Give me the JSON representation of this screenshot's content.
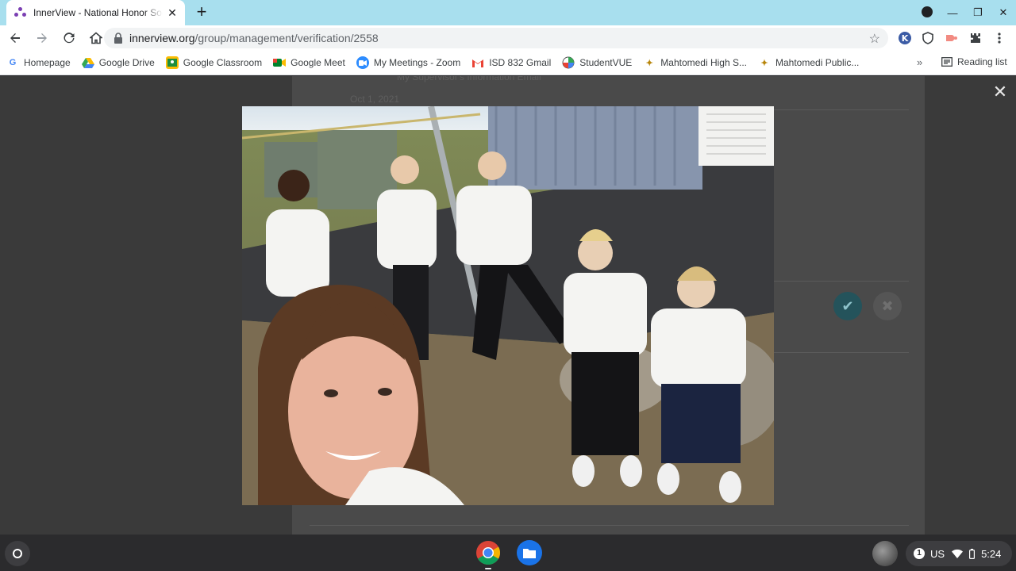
{
  "browser": {
    "tab": {
      "title": "InnerView - National Honor Society"
    },
    "url": {
      "host": "innerview.org",
      "path": "/group/management/verification/2558"
    }
  },
  "bookmarks": [
    {
      "label": "Homepage",
      "icon": "google-icon"
    },
    {
      "label": "Google Drive",
      "icon": "google-drive-icon"
    },
    {
      "label": "Google Classroom",
      "icon": "google-classroom-icon"
    },
    {
      "label": "Google Meet",
      "icon": "google-meet-icon"
    },
    {
      "label": "My Meetings - Zoom",
      "icon": "zoom-icon"
    },
    {
      "label": "ISD 832 Gmail",
      "icon": "gmail-icon"
    },
    {
      "label": "StudentVUE",
      "icon": "studentvue-icon"
    },
    {
      "label": "Mahtomedi High S...",
      "icon": "school-icon"
    },
    {
      "label": "Mahtomedi Public...",
      "icon": "school-icon"
    }
  ],
  "reading_list": "Reading list",
  "page": {
    "faint_text": "My Supervisor's Information  Email",
    "faint_date": "Oct 1, 2021"
  },
  "shelf": {
    "input_method": "US",
    "notification_count": "1",
    "time": "5:24"
  },
  "colors": {
    "tabstrip": "#a8dfee",
    "approve": "#24535b",
    "shelf": "#2b2b2d"
  }
}
